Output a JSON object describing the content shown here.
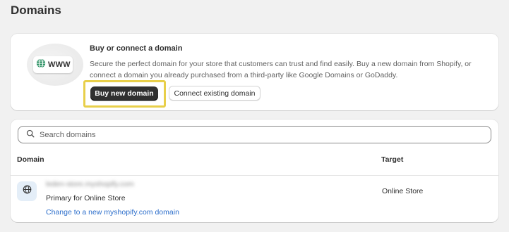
{
  "page": {
    "title": "Domains"
  },
  "promo": {
    "icon_text": "WWW",
    "icon_name": "globe-icon",
    "heading": "Buy or connect a domain",
    "body": "Secure the perfect domain for your store that customers can trust and find easily. Buy a new domain from Shopify, or connect a domain you already purchased from a third-party like Google Domains or GoDaddy.",
    "primary_button": "Buy new domain",
    "secondary_button": "Connect existing domain",
    "highlight_color": "#e8cf4a"
  },
  "search": {
    "placeholder": "Search domains",
    "value": "",
    "icon_name": "search-icon"
  },
  "table": {
    "columns": [
      "Domain",
      "Target"
    ],
    "rows": [
      {
        "icon_name": "globe-icon",
        "domain": "leden-store.myshopify.com",
        "subtitle": "Primary for Online Store",
        "link": "Change to a new myshopify.com domain",
        "target": "Online Store"
      }
    ]
  },
  "colors": {
    "background": "#f1f1f1",
    "primary_button": "#303030",
    "link": "#2c6ecb",
    "globe_tile": "#e4eef8"
  }
}
